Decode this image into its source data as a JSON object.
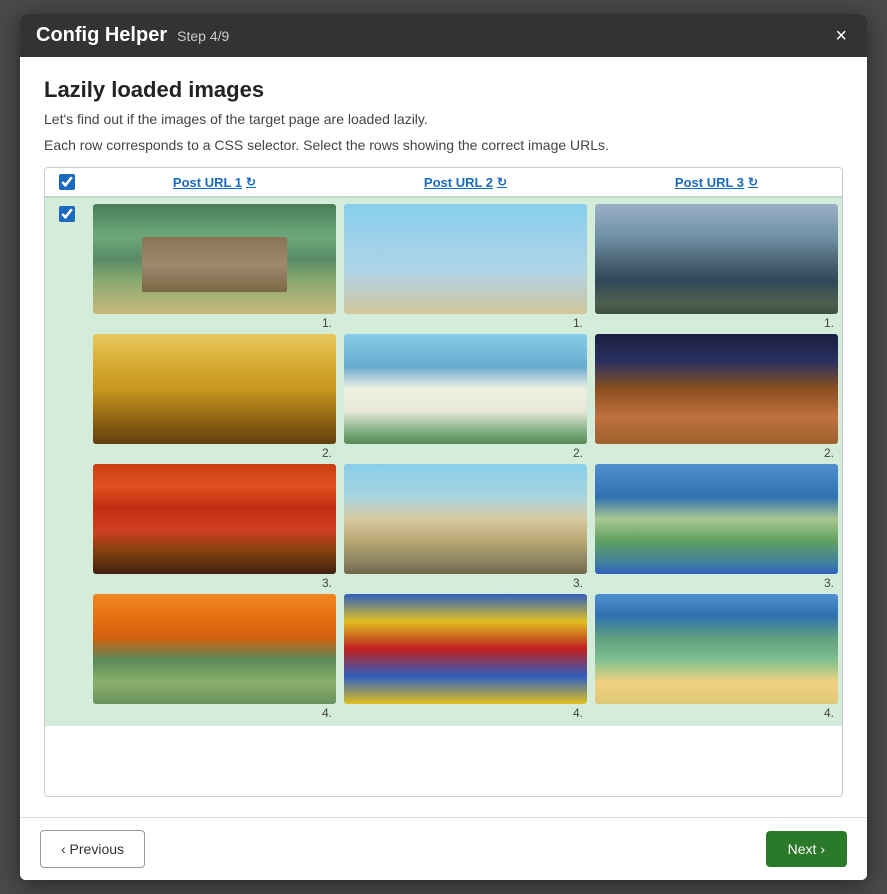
{
  "modal": {
    "title": "Config Helper",
    "step": "Step 4/9",
    "close_label": "×",
    "section_title": "Lazily loaded images",
    "description1": "Let's find out if the images of the target page are loaded lazily.",
    "description2": "Each row corresponds to a CSS selector. Select the rows showing the correct image URLs.",
    "columns": [
      {
        "label": "Post URL 1",
        "id": "col1"
      },
      {
        "label": "Post URL 2",
        "id": "col2"
      },
      {
        "label": "Post URL 3",
        "id": "col3"
      }
    ],
    "refresh_symbol": "↻",
    "rows": [
      {
        "checked": true,
        "images_col1": [
          "japanese-temple",
          "gate",
          "torii",
          "pavilion"
        ],
        "images_col2": [
          "cowboy",
          "capitol",
          "city-street",
          "flags"
        ],
        "images_col3": [
          "mountain",
          "chef",
          "rio-aerial",
          "rio-beach"
        ]
      }
    ],
    "footer": {
      "previous_label": "‹ Previous",
      "next_label": "Next ›"
    }
  }
}
